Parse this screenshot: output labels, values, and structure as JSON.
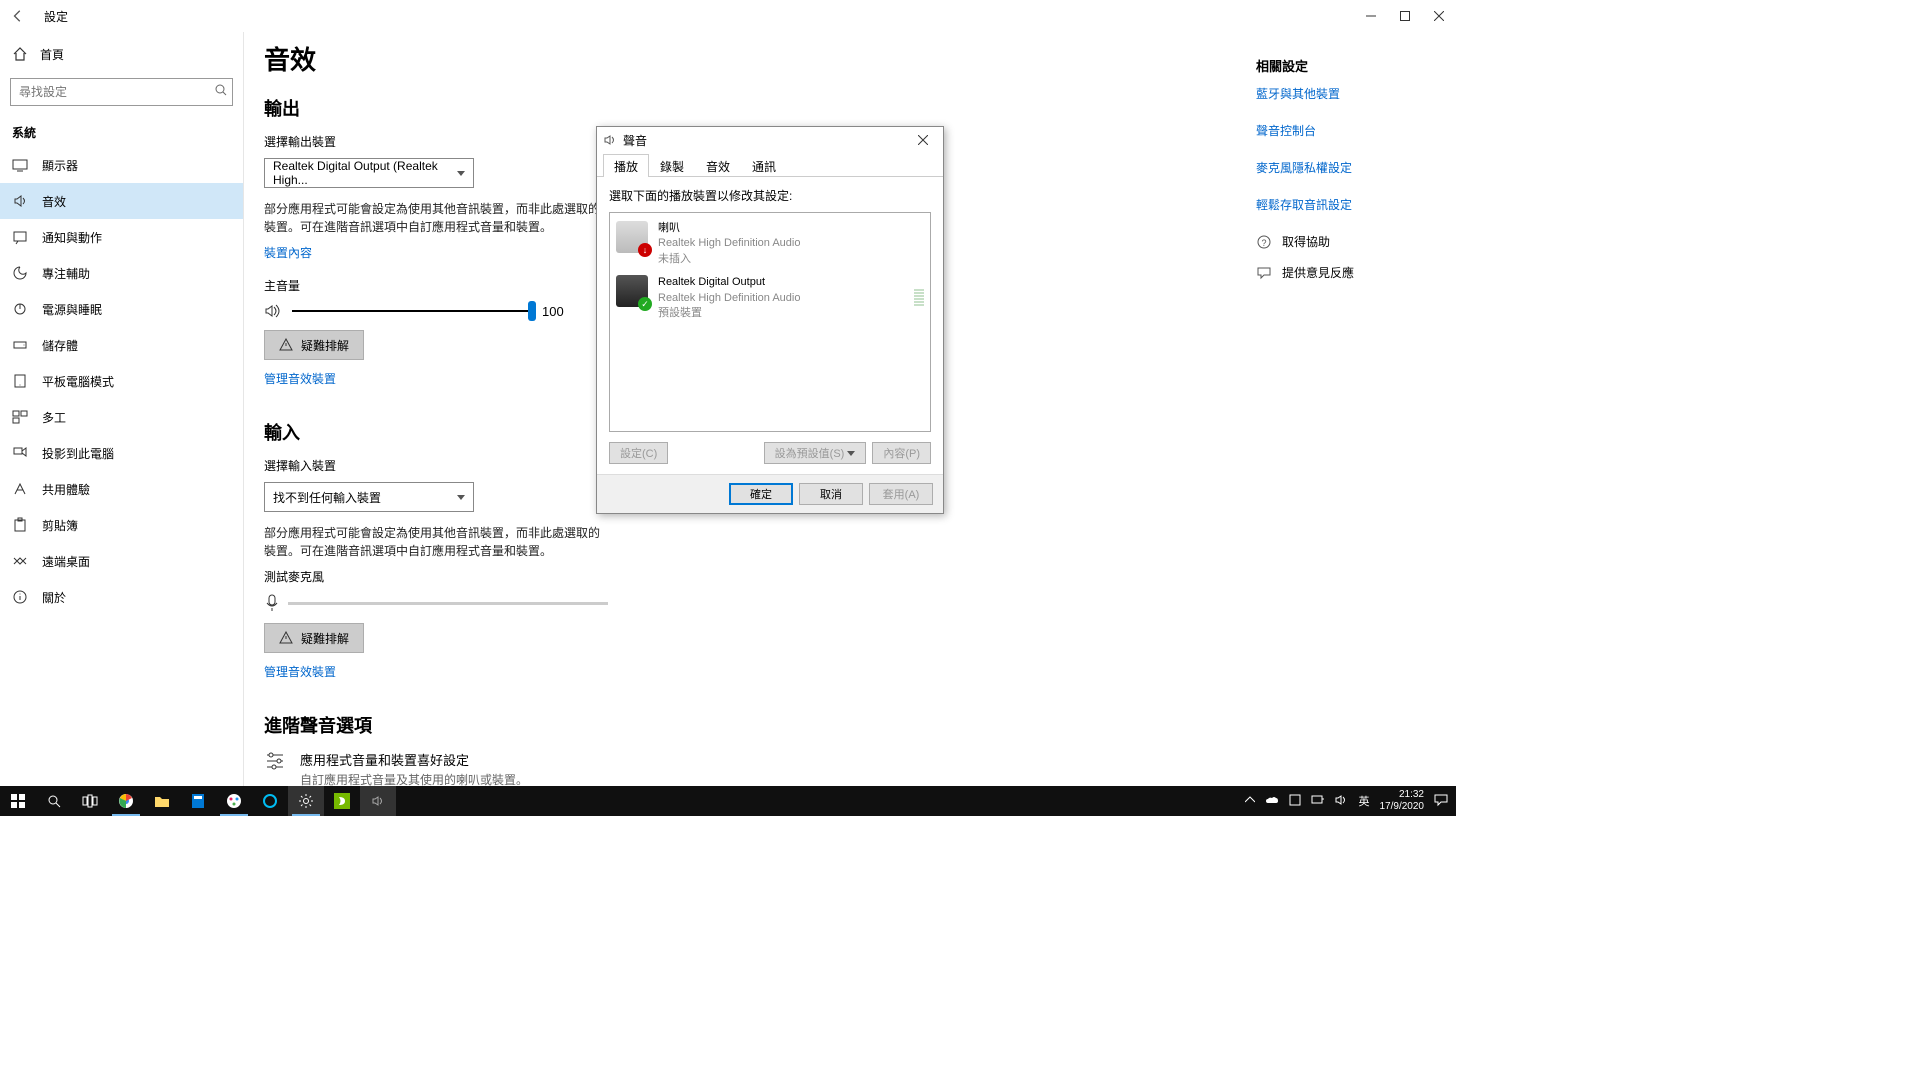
{
  "titlebar": {
    "title": "設定"
  },
  "sidebar": {
    "home": "首頁",
    "search_placeholder": "尋找設定",
    "section": "系統",
    "items": [
      {
        "label": "顯示器"
      },
      {
        "label": "音效"
      },
      {
        "label": "通知與動作"
      },
      {
        "label": "專注輔助"
      },
      {
        "label": "電源與睡眠"
      },
      {
        "label": "儲存體"
      },
      {
        "label": "平板電腦模式"
      },
      {
        "label": "多工"
      },
      {
        "label": "投影到此電腦"
      },
      {
        "label": "共用體驗"
      },
      {
        "label": "剪貼簿"
      },
      {
        "label": "遠端桌面"
      },
      {
        "label": "關於"
      }
    ]
  },
  "main": {
    "page_title": "音效",
    "output_heading": "輸出",
    "output_select_label": "選擇輸出裝置",
    "output_device": "Realtek Digital Output (Realtek High...",
    "output_desc": "部分應用程式可能會設定為使用其他音訊裝置，而非此處選取的裝置。可在進階音訊選項中自訂應用程式音量和裝置。",
    "device_props_link": "裝置內容",
    "master_volume_label": "主音量",
    "volume_value": "100",
    "troubleshoot": "疑難排解",
    "manage_devices_link": "管理音效裝置",
    "input_heading": "輸入",
    "input_select_label": "選擇輸入裝置",
    "input_device": "找不到任何輸入裝置",
    "input_desc": "部分應用程式可能會設定為使用其他音訊裝置，而非此處選取的裝置。可在進階音訊選項中自訂應用程式音量和裝置。",
    "test_mic_label": "測試麥克風",
    "advanced_heading": "進階聲音選項",
    "adv_title": "應用程式音量和裝置喜好設定",
    "adv_sub": "自訂應用程式音量及其使用的喇叭或裝置。"
  },
  "rightrail": {
    "heading": "相關設定",
    "links": [
      "藍牙與其他裝置",
      "聲音控制台",
      "麥克風隱私權設定",
      "輕鬆存取音訊設定"
    ],
    "help": "取得協助",
    "feedback": "提供意見反應"
  },
  "dialog": {
    "title": "聲音",
    "tabs": [
      "播放",
      "錄製",
      "音效",
      "通訊"
    ],
    "instruction": "選取下面的播放裝置以修改其設定:",
    "devices": [
      {
        "name": "喇叭",
        "sub": "Realtek High Definition Audio",
        "status": "未插入",
        "badge": "down"
      },
      {
        "name": "Realtek Digital Output",
        "sub": "Realtek High Definition Audio",
        "status": "預設裝置",
        "badge": "ok"
      }
    ],
    "btn_configure": "設定(C)",
    "btn_default": "設為預設值(S)",
    "btn_properties": "內容(P)",
    "btn_ok": "確定",
    "btn_cancel": "取消",
    "btn_apply": "套用(A)"
  },
  "taskbar": {
    "lang": "英",
    "time": "21:32",
    "date": "17/9/2020"
  }
}
